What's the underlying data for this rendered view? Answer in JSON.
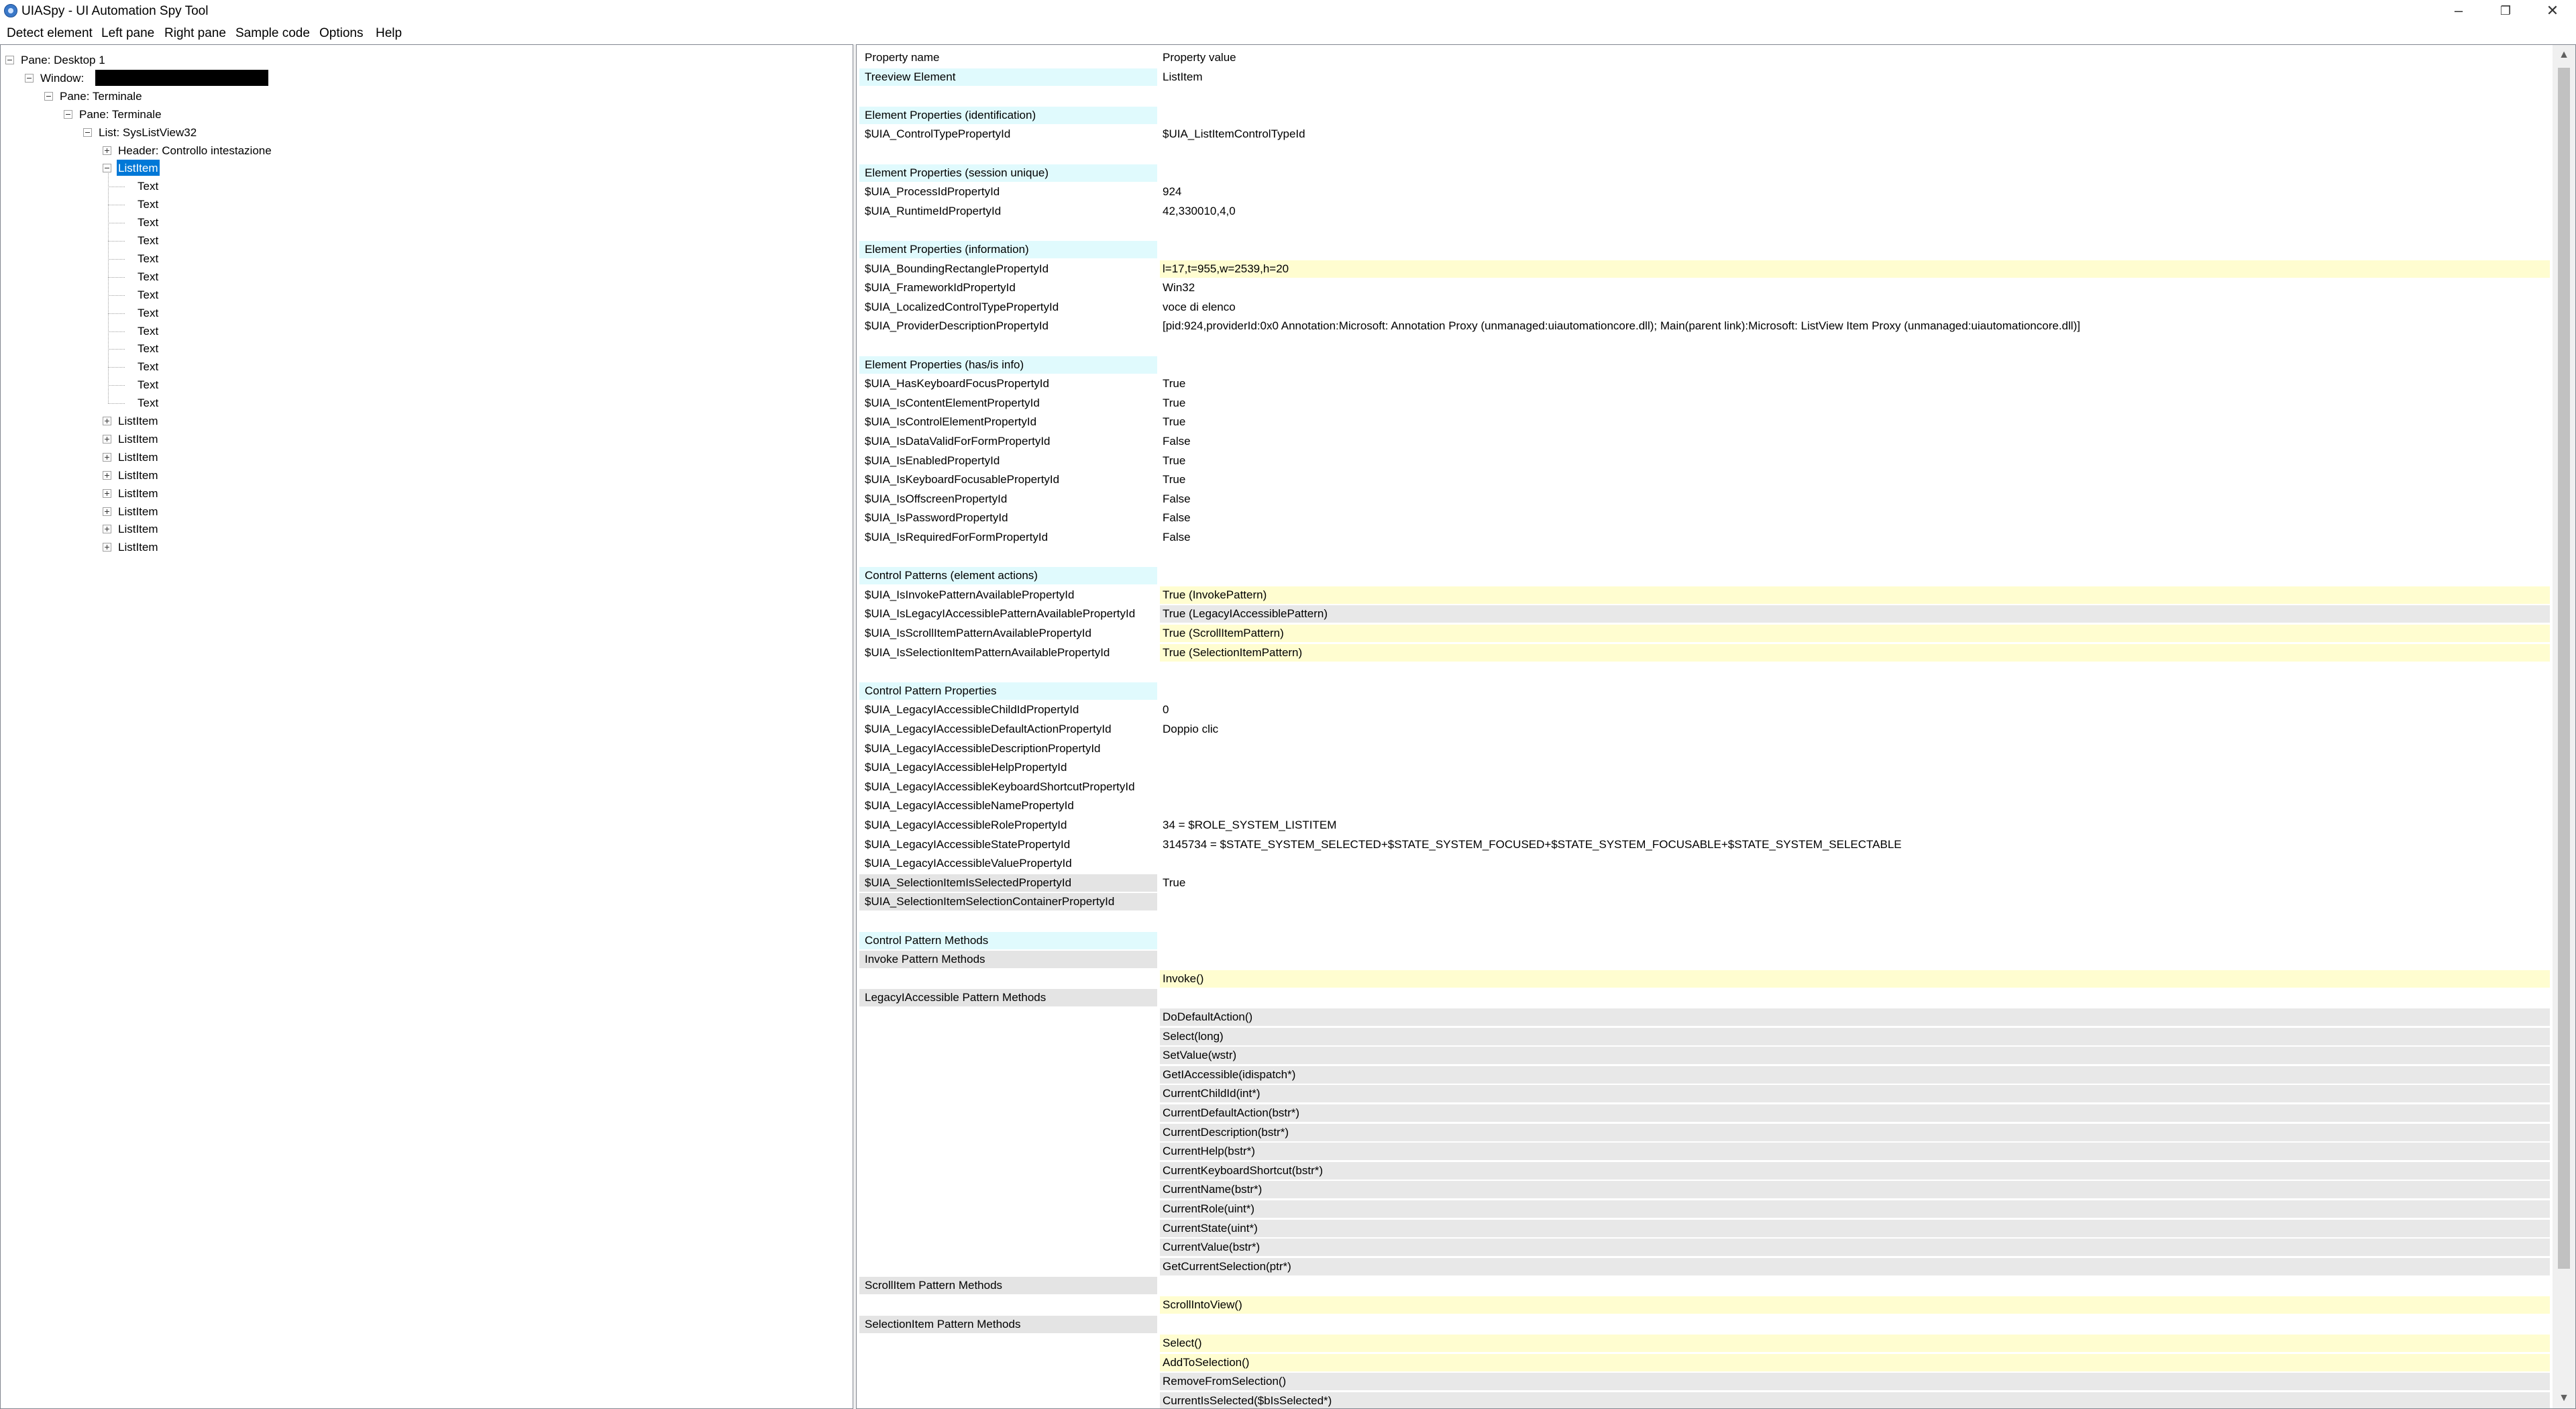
{
  "window": {
    "title": "UIASpy - UI Automation Spy Tool",
    "minimize_glyph": "–",
    "restore_glyph": "❐",
    "close_glyph": "✕"
  },
  "menu": [
    "Detect element",
    "Left pane",
    "Right pane",
    "Sample code",
    "Options",
    "Help"
  ],
  "tree": [
    {
      "label": "Pane: Desktop 1",
      "level": 0,
      "expander": "minus"
    },
    {
      "label": "Window:",
      "level": 1,
      "expander": "minus",
      "redacted": true
    },
    {
      "label": "Pane: Terminale",
      "level": 2,
      "expander": "minus"
    },
    {
      "label": "Pane: Terminale",
      "level": 3,
      "expander": "minus"
    },
    {
      "label": "List: SysListView32",
      "level": 4,
      "expander": "minus"
    },
    {
      "label": "Header: Controllo intestazione",
      "level": 5,
      "expander": "plus"
    },
    {
      "label": "ListItem",
      "level": 5,
      "expander": "minus",
      "selected": true
    },
    {
      "label": "Text",
      "level": 6,
      "expander": "none"
    },
    {
      "label": "Text",
      "level": 6,
      "expander": "none"
    },
    {
      "label": "Text",
      "level": 6,
      "expander": "none"
    },
    {
      "label": "Text",
      "level": 6,
      "expander": "none"
    },
    {
      "label": "Text",
      "level": 6,
      "expander": "none"
    },
    {
      "label": "Text",
      "level": 6,
      "expander": "none"
    },
    {
      "label": "Text",
      "level": 6,
      "expander": "none"
    },
    {
      "label": "Text",
      "level": 6,
      "expander": "none"
    },
    {
      "label": "Text",
      "level": 6,
      "expander": "none"
    },
    {
      "label": "Text",
      "level": 6,
      "expander": "none"
    },
    {
      "label": "Text",
      "level": 6,
      "expander": "none"
    },
    {
      "label": "Text",
      "level": 6,
      "expander": "none"
    },
    {
      "label": "Text",
      "level": 6,
      "expander": "none"
    },
    {
      "label": "ListItem",
      "level": 5,
      "expander": "plus"
    },
    {
      "label": "ListItem",
      "level": 5,
      "expander": "plus"
    },
    {
      "label": "ListItem",
      "level": 5,
      "expander": "plus"
    },
    {
      "label": "ListItem",
      "level": 5,
      "expander": "plus"
    },
    {
      "label": "ListItem",
      "level": 5,
      "expander": "plus"
    },
    {
      "label": "ListItem",
      "level": 5,
      "expander": "plus"
    },
    {
      "label": "ListItem",
      "level": 5,
      "expander": "plus"
    },
    {
      "label": "ListItem",
      "level": 5,
      "expander": "plus"
    }
  ],
  "properties": [
    {
      "name": "Property name",
      "value": "Property value",
      "style": "header"
    },
    {
      "name": "Treeview Element",
      "value": "ListItem",
      "style": "cyan"
    },
    {
      "name": "",
      "value": "",
      "style": "blank"
    },
    {
      "name": "Element Properties (identification)",
      "value": "",
      "style": "cyan"
    },
    {
      "name": "$UIA_ControlTypePropertyId",
      "value": "$UIA_ListItemControlTypeId",
      "style": "plain"
    },
    {
      "name": "",
      "value": "",
      "style": "blank"
    },
    {
      "name": "Element Properties (session unique)",
      "value": "",
      "style": "cyan"
    },
    {
      "name": "$UIA_ProcessIdPropertyId",
      "value": "924",
      "style": "plain"
    },
    {
      "name": "$UIA_RuntimeIdPropertyId",
      "value": "42,330010,4,0",
      "style": "plain"
    },
    {
      "name": "",
      "value": "",
      "style": "blank"
    },
    {
      "name": "Element Properties (information)",
      "value": "",
      "style": "cyan"
    },
    {
      "name": "$UIA_BoundingRectanglePropertyId",
      "value": "l=17,t=955,w=2539,h=20",
      "style": "plain",
      "val": "yellow"
    },
    {
      "name": "$UIA_FrameworkIdPropertyId",
      "value": "Win32",
      "style": "plain"
    },
    {
      "name": "$UIA_LocalizedControlTypePropertyId",
      "value": "voce di elenco",
      "style": "plain"
    },
    {
      "name": "$UIA_ProviderDescriptionPropertyId",
      "value": "[pid:924,providerId:0x0 Annotation:Microsoft: Annotation Proxy (unmanaged:uiautomationcore.dll); Main(parent link):Microsoft: ListView Item Proxy (unmanaged:uiautomationcore.dll)]",
      "style": "plain"
    },
    {
      "name": "",
      "value": "",
      "style": "blank"
    },
    {
      "name": "Element Properties (has/is info)",
      "value": "",
      "style": "cyan"
    },
    {
      "name": "$UIA_HasKeyboardFocusPropertyId",
      "value": "True",
      "style": "plain"
    },
    {
      "name": "$UIA_IsContentElementPropertyId",
      "value": "True",
      "style": "plain"
    },
    {
      "name": "$UIA_IsControlElementPropertyId",
      "value": "True",
      "style": "plain"
    },
    {
      "name": "$UIA_IsDataValidForFormPropertyId",
      "value": "False",
      "style": "plain"
    },
    {
      "name": "$UIA_IsEnabledPropertyId",
      "value": "True",
      "style": "plain"
    },
    {
      "name": "$UIA_IsKeyboardFocusablePropertyId",
      "value": "True",
      "style": "plain"
    },
    {
      "name": "$UIA_IsOffscreenPropertyId",
      "value": "False",
      "style": "plain"
    },
    {
      "name": "$UIA_IsPasswordPropertyId",
      "value": "False",
      "style": "plain"
    },
    {
      "name": "$UIA_IsRequiredForFormPropertyId",
      "value": "False",
      "style": "plain"
    },
    {
      "name": "",
      "value": "",
      "style": "blank"
    },
    {
      "name": "Control Patterns (element actions)",
      "value": "",
      "style": "cyan"
    },
    {
      "name": "$UIA_IsInvokePatternAvailablePropertyId",
      "value": "True (InvokePattern)",
      "style": "plain",
      "val": "yellow"
    },
    {
      "name": "$UIA_IsLegacyIAccessiblePatternAvailablePropertyId",
      "value": "True (LegacyIAccessiblePattern)",
      "style": "plain",
      "val": "gray"
    },
    {
      "name": "$UIA_IsScrollItemPatternAvailablePropertyId",
      "value": "True (ScrollItemPattern)",
      "style": "plain",
      "val": "yellow"
    },
    {
      "name": "$UIA_IsSelectionItemPatternAvailablePropertyId",
      "value": "True (SelectionItemPattern)",
      "style": "plain",
      "val": "yellow"
    },
    {
      "name": "",
      "value": "",
      "style": "blank"
    },
    {
      "name": "Control Pattern Properties",
      "value": "",
      "style": "cyan"
    },
    {
      "name": "$UIA_LegacyIAccessibleChildIdPropertyId",
      "value": "0",
      "style": "plain"
    },
    {
      "name": "$UIA_LegacyIAccessibleDefaultActionPropertyId",
      "value": "Doppio clic",
      "style": "plain"
    },
    {
      "name": "$UIA_LegacyIAccessibleDescriptionPropertyId",
      "value": "",
      "style": "plain"
    },
    {
      "name": "$UIA_LegacyIAccessibleHelpPropertyId",
      "value": "",
      "style": "plain"
    },
    {
      "name": "$UIA_LegacyIAccessibleKeyboardShortcutPropertyId",
      "value": "",
      "style": "plain"
    },
    {
      "name": "$UIA_LegacyIAccessibleNamePropertyId",
      "value": "",
      "style": "plain"
    },
    {
      "name": "$UIA_LegacyIAccessibleRolePropertyId",
      "value": "34 = $ROLE_SYSTEM_LISTITEM",
      "style": "plain"
    },
    {
      "name": "$UIA_LegacyIAccessibleStatePropertyId",
      "value": "3145734 = $STATE_SYSTEM_SELECTED+$STATE_SYSTEM_FOCUSED+$STATE_SYSTEM_FOCUSABLE+$STATE_SYSTEM_SELECTABLE",
      "style": "plain"
    },
    {
      "name": "$UIA_LegacyIAccessibleValuePropertyId",
      "value": "",
      "style": "plain"
    },
    {
      "name": "$UIA_SelectionItemIsSelectedPropertyId",
      "value": "True",
      "style": "gray"
    },
    {
      "name": "$UIA_SelectionItemSelectionContainerPropertyId",
      "value": "",
      "style": "gray"
    },
    {
      "name": "",
      "value": "",
      "style": "blank"
    },
    {
      "name": "Control Pattern Methods",
      "value": "",
      "style": "cyan"
    },
    {
      "name": "Invoke Pattern Methods",
      "value": "",
      "style": "gray"
    },
    {
      "name": "",
      "value": "Invoke()",
      "style": "plain",
      "val": "yellow"
    },
    {
      "name": "LegacyIAccessible Pattern Methods",
      "value": "",
      "style": "gray"
    },
    {
      "name": "",
      "value": "DoDefaultAction()",
      "style": "plain",
      "val": "gray"
    },
    {
      "name": "",
      "value": "Select(long)",
      "style": "plain",
      "val": "gray"
    },
    {
      "name": "",
      "value": "SetValue(wstr)",
      "style": "plain",
      "val": "gray"
    },
    {
      "name": "",
      "value": "GetIAccessible(idispatch*)",
      "style": "plain",
      "val": "gray"
    },
    {
      "name": "",
      "value": "CurrentChildId(int*)",
      "style": "plain",
      "val": "gray"
    },
    {
      "name": "",
      "value": "CurrentDefaultAction(bstr*)",
      "style": "plain",
      "val": "gray"
    },
    {
      "name": "",
      "value": "CurrentDescription(bstr*)",
      "style": "plain",
      "val": "gray"
    },
    {
      "name": "",
      "value": "CurrentHelp(bstr*)",
      "style": "plain",
      "val": "gray"
    },
    {
      "name": "",
      "value": "CurrentKeyboardShortcut(bstr*)",
      "style": "plain",
      "val": "gray"
    },
    {
      "name": "",
      "value": "CurrentName(bstr*)",
      "style": "plain",
      "val": "gray"
    },
    {
      "name": "",
      "value": "CurrentRole(uint*)",
      "style": "plain",
      "val": "gray"
    },
    {
      "name": "",
      "value": "CurrentState(uint*)",
      "style": "plain",
      "val": "gray"
    },
    {
      "name": "",
      "value": "CurrentValue(bstr*)",
      "style": "plain",
      "val": "gray"
    },
    {
      "name": "",
      "value": "GetCurrentSelection(ptr*)",
      "style": "plain",
      "val": "gray"
    },
    {
      "name": "ScrollItem Pattern Methods",
      "value": "",
      "style": "gray"
    },
    {
      "name": "",
      "value": "ScrollIntoView()",
      "style": "plain",
      "val": "yellow"
    },
    {
      "name": "SelectionItem Pattern Methods",
      "value": "",
      "style": "gray"
    },
    {
      "name": "",
      "value": "Select()",
      "style": "plain",
      "val": "yellow"
    },
    {
      "name": "",
      "value": "AddToSelection()",
      "style": "plain",
      "val": "yellow"
    },
    {
      "name": "",
      "value": "RemoveFromSelection()",
      "style": "plain",
      "val": "gray"
    },
    {
      "name": "",
      "value": "CurrentIsSelected($bIsSelected*)",
      "style": "plain",
      "val": "gray"
    }
  ],
  "scrollbar": {
    "up_glyph": "▲",
    "down_glyph": "▼"
  }
}
